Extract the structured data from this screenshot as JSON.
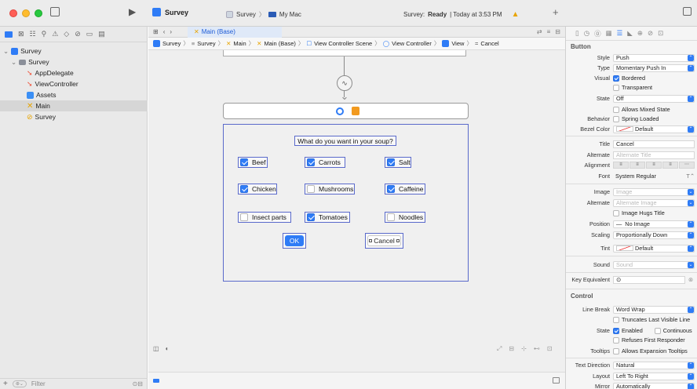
{
  "toolbar": {
    "project": "Survey",
    "scheme": "Survey",
    "destination": "My Mac",
    "status_prefix": "Survey: ",
    "status_bold": "Ready",
    "status_suffix": " | Today at 3:53 PM",
    "add": "+"
  },
  "navigator": {
    "items": [
      {
        "label": "Survey"
      },
      {
        "label": "Survey"
      },
      {
        "label": "AppDelegate"
      },
      {
        "label": "ViewController"
      },
      {
        "label": "Assets"
      },
      {
        "label": "Main"
      },
      {
        "label": "Survey"
      }
    ],
    "filter_placeholder": "Filter"
  },
  "editor": {
    "tab": "Main (Base)",
    "breadcrumb": [
      "Survey",
      "Survey",
      "Main",
      "Main (Base)",
      "View Controller Scene",
      "View Controller",
      "View",
      "Cancel"
    ]
  },
  "scene": {
    "question": "What do you want in your soup?",
    "options": [
      {
        "label": "Beef",
        "checked": true
      },
      {
        "label": "Carrots",
        "checked": true
      },
      {
        "label": "Salt",
        "checked": true
      },
      {
        "label": "Chicken",
        "checked": true
      },
      {
        "label": "Mushrooms",
        "checked": false
      },
      {
        "label": "Caffeine",
        "checked": true
      },
      {
        "label": "Insect parts",
        "checked": false
      },
      {
        "label": "Tomatoes",
        "checked": true
      },
      {
        "label": "Noodles",
        "checked": false
      }
    ],
    "ok_label": "OK",
    "cancel_label": "Cancel"
  },
  "inspector": {
    "button_section": "Button",
    "style_label": "Style",
    "style_value": "Push",
    "type_label": "Type",
    "type_value": "Momentary Push In",
    "visual_label": "Visual",
    "bordered": "Bordered",
    "transparent": "Transparent",
    "state_label": "State",
    "state_value": "Off",
    "allows_mixed": "Allows Mixed State",
    "behavior_label": "Behavior",
    "spring_loaded": "Spring Loaded",
    "bezel_label": "Bezel Color",
    "bezel_value": "Default",
    "title_label": "Title",
    "title_value": "Cancel",
    "alternate_label": "Alternate",
    "alternate_placeholder": "Alternate Title",
    "alignment_label": "Alignment",
    "font_label": "Font",
    "font_value": "System Regular",
    "image_label": "Image",
    "image_placeholder": "Image",
    "alt_image_label": "Alternate",
    "alt_image_placeholder": "Alternate Image",
    "hugs_title": "Image Hugs Title",
    "position_label": "Position",
    "position_value": "No Image",
    "scaling_label": "Scaling",
    "scaling_value": "Proportionally Down",
    "tint_label": "Tint",
    "tint_value": "Default",
    "sound_label": "Sound",
    "sound_placeholder": "Sound",
    "key_equiv_label": "Key Equivalent",
    "control_section": "Control",
    "line_break_label": "Line Break",
    "line_break_value": "Word Wrap",
    "truncates": "Truncates Last Visible Line",
    "ctrl_state_label": "State",
    "enabled": "Enabled",
    "continuous": "Continuous",
    "refuses_first": "Refuses First Responder",
    "tooltips_label": "Tooltips",
    "allows_tooltips": "Allows Expansion Tooltips",
    "text_dir_label": "Text Direction",
    "text_dir_value": "Natural",
    "layout_label": "Layout",
    "layout_value": "Left To Right",
    "mirror_label": "Mirror",
    "mirror_value": "Automatically"
  },
  "colors": {
    "accent": "#2f7cf6",
    "selection_outline": "#5a6acb"
  }
}
